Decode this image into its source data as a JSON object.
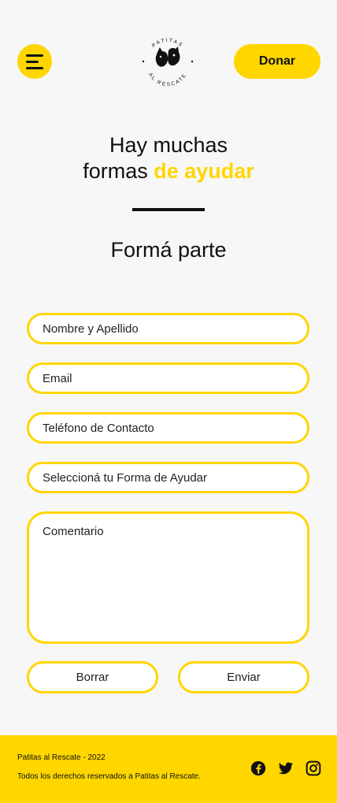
{
  "header": {
    "menu_icon": "hamburger-menu-icon",
    "logo": {
      "text_top": "PATITAS",
      "text_bottom": "AL RESCATE"
    },
    "donate_label": "Donar"
  },
  "hero": {
    "title_line1": "Hay muchas",
    "title_line2_plain": "formas ",
    "title_line2_accent": "de ayudar",
    "subtitle": "Formá parte"
  },
  "form": {
    "name_placeholder": "Nombre y Apellido",
    "email_placeholder": "Email",
    "phone_placeholder": "Teléfono de Contacto",
    "help_type_placeholder": "Seleccioná tu Forma de Ayudar",
    "comment_placeholder": "Comentario",
    "clear_label": "Borrar",
    "submit_label": "Enviar"
  },
  "footer": {
    "copyright": "Patitas al Rescate - 2022",
    "rights": "Todos los derechos reservados a Patitas al Rescate.",
    "social": [
      "facebook-icon",
      "twitter-icon",
      "instagram-icon"
    ]
  },
  "colors": {
    "accent": "#ffd600",
    "background": "#f7f7f7",
    "text": "#111111"
  }
}
